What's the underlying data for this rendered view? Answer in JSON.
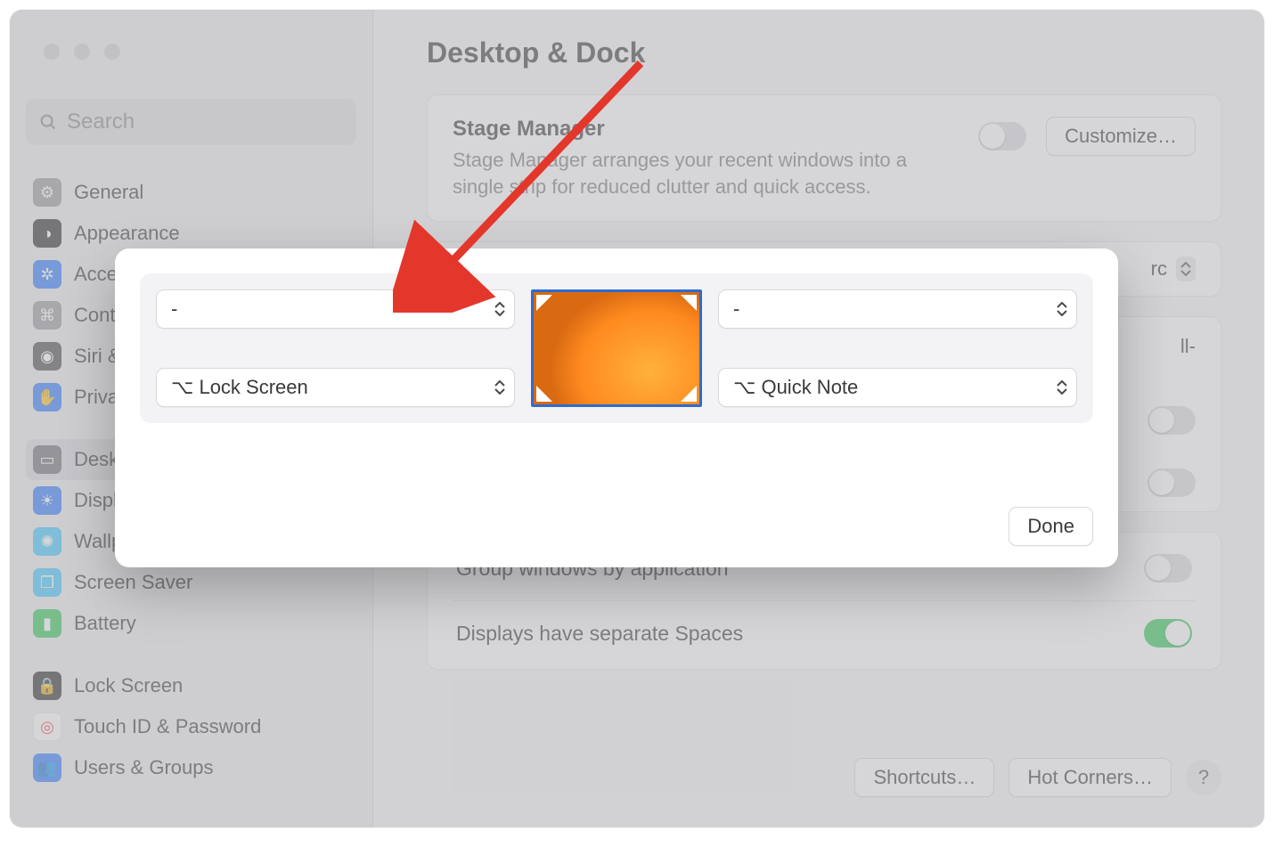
{
  "search": {
    "placeholder": "Search"
  },
  "page": {
    "title": "Desktop & Dock"
  },
  "sidebar": {
    "items": [
      {
        "label": "General",
        "icon": "gear-icon",
        "bg": "#9a9a9e"
      },
      {
        "label": "Appearance",
        "icon": "appearance-icon",
        "bg": "#2b2b2d"
      },
      {
        "label": "Accessibility",
        "icon": "accessibility-icon",
        "bg": "#2f7bff"
      },
      {
        "label": "Control Center",
        "icon": "control-center-icon",
        "bg": "#9a9a9e"
      },
      {
        "label": "Siri & Spotlight",
        "icon": "siri-icon",
        "bg": "#4a4a4c"
      },
      {
        "label": "Privacy & Security",
        "icon": "privacy-icon",
        "bg": "#2f7bff"
      },
      {
        "label": "Desktop & Dock",
        "icon": "desktop-dock-icon",
        "bg": "#6f6f73",
        "selected": true
      },
      {
        "label": "Displays",
        "icon": "displays-icon",
        "bg": "#2f7bff"
      },
      {
        "label": "Wallpaper",
        "icon": "wallpaper-icon",
        "bg": "#3fc8ff"
      },
      {
        "label": "Screen Saver",
        "icon": "screen-saver-icon",
        "bg": "#3fc8ff"
      },
      {
        "label": "Battery",
        "icon": "battery-icon",
        "bg": "#34c759"
      },
      {
        "label": "Lock Screen",
        "icon": "lock-screen-icon",
        "bg": "#2b2b2d"
      },
      {
        "label": "Touch ID & Password",
        "icon": "touch-id-icon",
        "bg": "#ffffff"
      },
      {
        "label": "Users & Groups",
        "icon": "users-groups-icon",
        "bg": "#2f7bff"
      }
    ]
  },
  "stageManager": {
    "title": "Stage Manager",
    "sub": "Stage Manager arranges your recent windows into a single strip for reduced clutter and quick access.",
    "customize": "Customize…",
    "on": false
  },
  "browserRow": {
    "suffix": "rc"
  },
  "fullRow": {
    "suffix": "ll-"
  },
  "settings": {
    "groupWindows": {
      "label": "Group windows by application",
      "on": false
    },
    "separateSpaces": {
      "label": "Displays have separate Spaces",
      "on": true
    }
  },
  "toggle3": {
    "on": false
  },
  "toggle4": {
    "on": false
  },
  "footer": {
    "shortcuts": "Shortcuts…",
    "hotCorners": "Hot Corners…",
    "help": "?"
  },
  "modal": {
    "tl": "-",
    "tr": "-",
    "bl": "⌥ Lock Screen",
    "br": "⌥ Quick Note",
    "done": "Done"
  }
}
